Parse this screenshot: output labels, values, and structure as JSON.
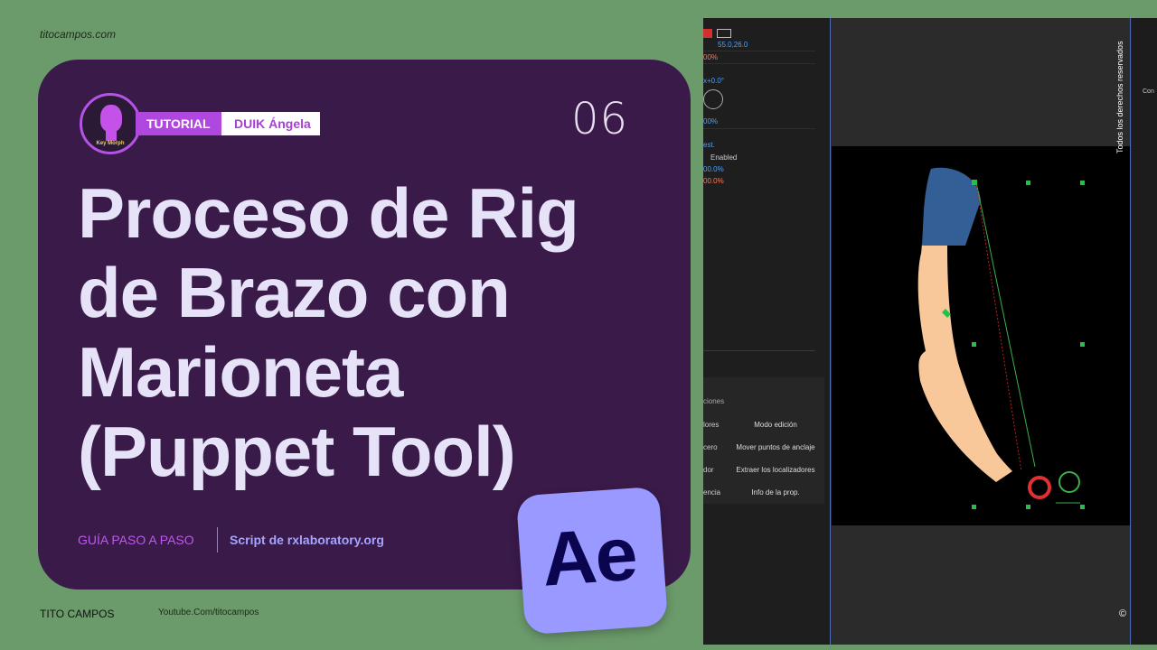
{
  "site": "titocampos.com",
  "badge": {
    "tutorial": "TUTORIAL",
    "series": "DUIK Ángela",
    "avatar_label": "Key Morph"
  },
  "episode": "06",
  "title_lines": [
    "Proceso de Rig",
    "de Brazo con",
    "Marioneta",
    "(Puppet Tool)"
  ],
  "guide": "GUÍA PASO A PASO",
  "script": "Script de rxlaboratory.org",
  "ae_logo": "Ae",
  "footer": {
    "author": "TITO CAMPOS",
    "youtube": "Youtube.Com/titocampos"
  },
  "ae_screen": {
    "values": [
      "55.0,26.0",
      "00%",
      "x+0.0°",
      "00%",
      "est.",
      "Enabled",
      "00.0%",
      "00.0%"
    ],
    "tools_header": "ciones",
    "tools": [
      "Modo edición",
      "Mover puntos de anclaje",
      "Extraer los localizadores",
      "Info de la prop."
    ],
    "tools_left": [
      "lores",
      "cero",
      "dor",
      "encia"
    ],
    "rights": "Todos los derechos reservados",
    "copyright": "©",
    "right_label": "Con"
  },
  "colors": {
    "bg": "#6b9a6b",
    "card": "#3a1a49",
    "accent": "#b048e0",
    "ae": "#9999ff"
  }
}
